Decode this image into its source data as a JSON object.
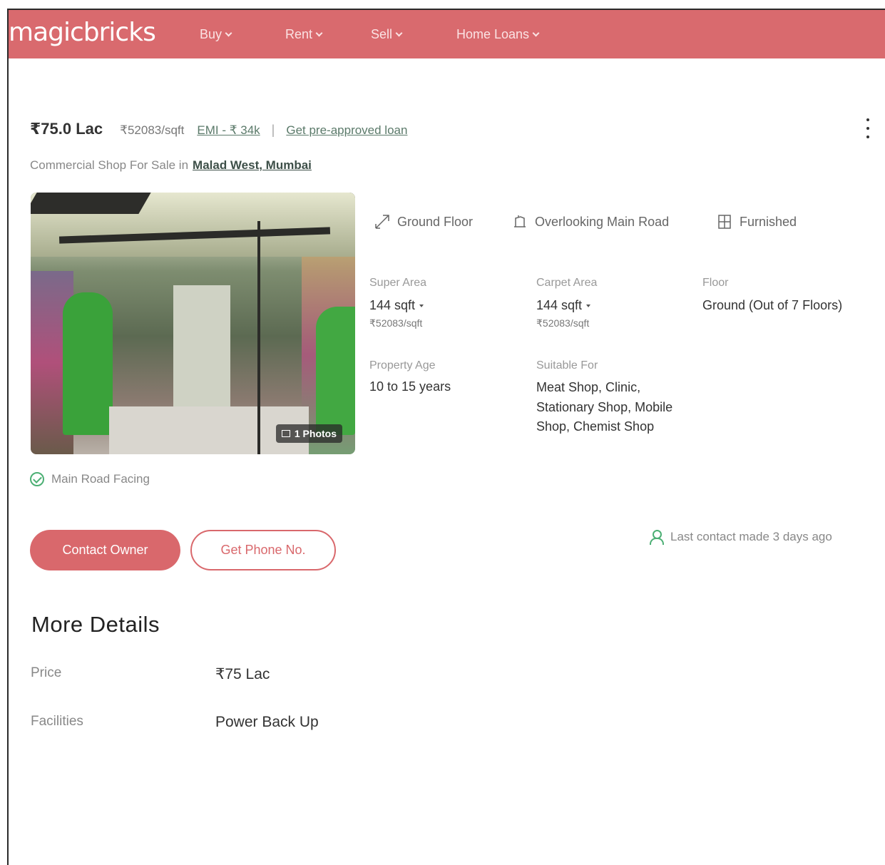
{
  "navbar": {
    "logo": "magicbricks",
    "items": [
      {
        "label": "Buy"
      },
      {
        "label": "Rent"
      },
      {
        "label": "Sell"
      },
      {
        "label": "Home Loans"
      }
    ],
    "color": "#d96a6e"
  },
  "listing": {
    "price": "₹75.0 Lac",
    "price_per_sqft": "₹52083/sqft",
    "emi": "EMI - ₹ 34k",
    "separator": "|",
    "loan_link": "Get pre-approved loan",
    "subtitle": "Commercial Shop For Sale in",
    "location": "Malad West, Mumbai",
    "photo_count": "1 Photos",
    "features": [
      {
        "icon": "staircase-icon",
        "label": "Ground Floor"
      },
      {
        "icon": "road-view-icon",
        "label": "Overlooking Main Road"
      },
      {
        "icon": "furnished-icon",
        "label": "Furnished"
      }
    ],
    "specs": {
      "super_area": {
        "label": "Super Area",
        "value": "144 sqft",
        "sub": "₹52083/sqft"
      },
      "carpet_area": {
        "label": "Carpet Area",
        "value": "144 sqft",
        "sub": "₹52083/sqft"
      },
      "floor": {
        "label": "Floor",
        "value": "Ground (Out of 7 Floors)"
      },
      "property_age": {
        "label": "Property Age",
        "value": "10 to 15 years"
      },
      "suitable_for": {
        "label": "Suitable For",
        "value": "Meat Shop, Clinic, Stationary Shop, Mobile Shop, Chemist Shop"
      }
    },
    "highlight": "Main Road Facing",
    "contact_button": "Contact Owner",
    "phone_button": "Get Phone No.",
    "last_contact": "Last contact made 3 days ago"
  },
  "more_details": {
    "title": "More Details",
    "rows": [
      {
        "label": "Price",
        "value": "₹75 Lac"
      },
      {
        "label": "Facilities",
        "value": "Power Back Up"
      }
    ]
  },
  "colors": {
    "accent": "#d9686c",
    "success": "#4caf74",
    "link": "#5b7a6a"
  }
}
